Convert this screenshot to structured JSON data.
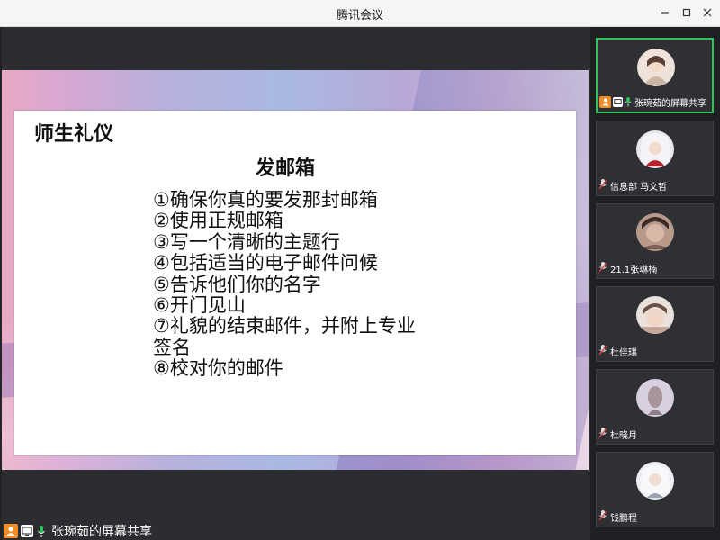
{
  "window": {
    "title": "腾讯会议",
    "minimize_icon": "minimize-icon",
    "maximize_icon": "maximize-icon",
    "close_icon": "close-icon"
  },
  "slide": {
    "title": "师生礼仪",
    "heading": "发邮箱",
    "items": [
      "①确保你真的要发那封邮箱",
      "②使用正规邮箱",
      "③写一个清晰的主题行",
      "④包括适当的电子邮件问候",
      "⑤告诉他们你的名字",
      "⑥开门见山",
      "⑦礼貌的结束邮件，并附上专业签名",
      "⑧校对你的邮件"
    ]
  },
  "sharer": {
    "label": "张琬茹的屏幕共享"
  },
  "participants": [
    {
      "name": "张琬茹的屏幕共享",
      "active": true,
      "mic": "on",
      "avatar_color": "#e9d4c9"
    },
    {
      "name": "信息部  马文哲",
      "active": false,
      "mic": "muted",
      "avatar_color": "#cfd6e3"
    },
    {
      "name": "21.1张琳楠",
      "active": false,
      "mic": "muted",
      "avatar_color": "#b88b7a"
    },
    {
      "name": "杜佳琪",
      "active": false,
      "mic": "muted",
      "avatar_color": "#d9c5b8"
    },
    {
      "name": "杜晓月",
      "active": false,
      "mic": "muted",
      "avatar_color": "#cbbfd2"
    },
    {
      "name": "钱鹏程",
      "active": false,
      "mic": "muted",
      "avatar_color": "#d6d9e0"
    }
  ],
  "colors": {
    "accent_green": "#2fc45a",
    "share_orange": "#f08c2a",
    "mute_red": "#e03a3a"
  }
}
